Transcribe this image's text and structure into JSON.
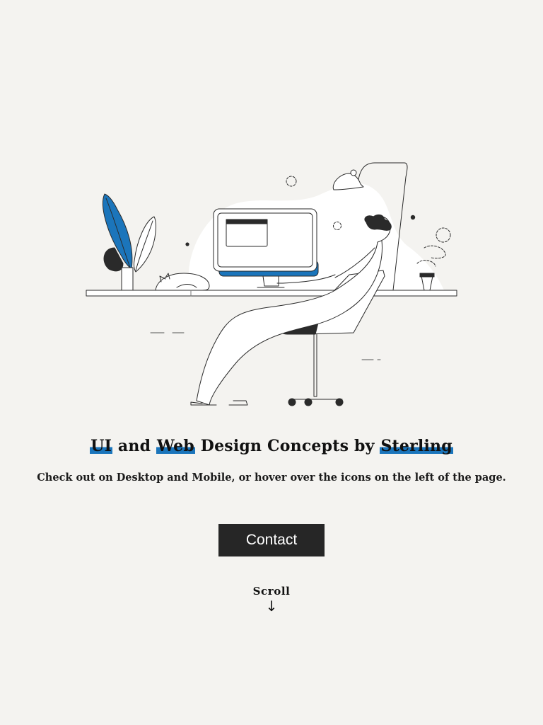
{
  "colors": {
    "background": "#f4f3f0",
    "accent": "#1b75bb",
    "button_background": "#262626",
    "button_text": "#ffffff",
    "text": "#111111"
  },
  "hero": {
    "illustration_icon": "person-relaxing-at-desk-illustration",
    "title": {
      "part1": "UI",
      "part2": " and ",
      "part3": "Web",
      "part4": " Design Concepts by ",
      "part5": "Sterling"
    },
    "subtitle": "Check out on Desktop and Mobile, or hover over the icons on the left of the page.",
    "contact_label": "Contact",
    "scroll_label": "Scroll",
    "scroll_arrow": "↓"
  }
}
